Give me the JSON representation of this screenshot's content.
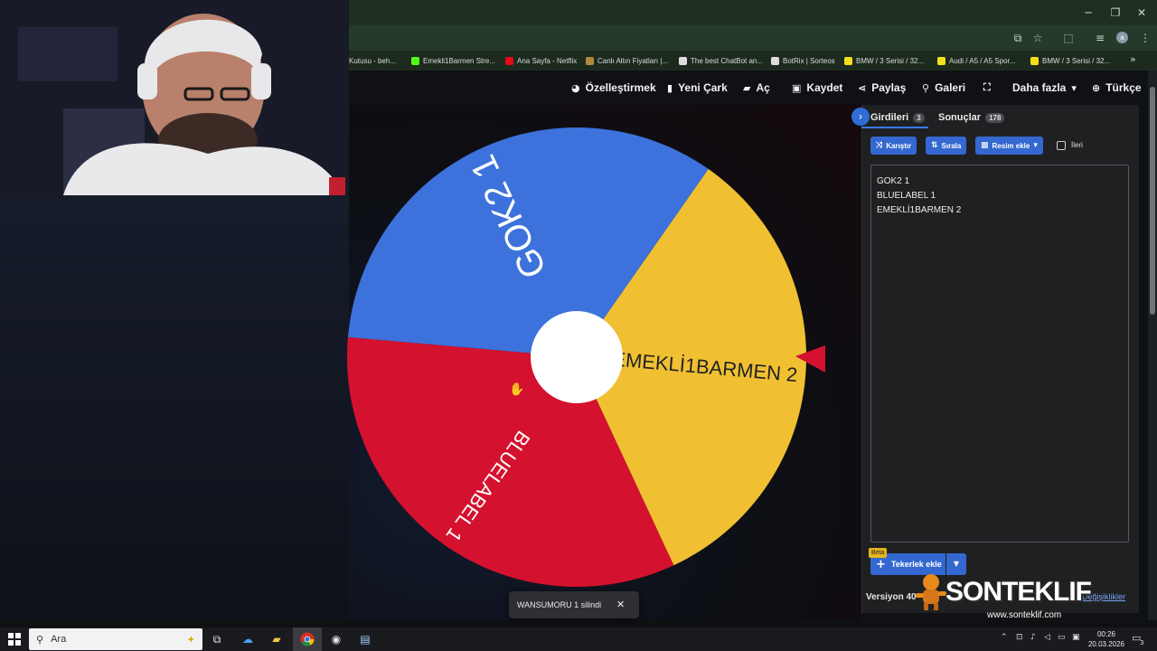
{
  "bookmarks": [
    {
      "label": "Kutusu - beh...",
      "icon": "mail-icon",
      "color": "#888888"
    },
    {
      "label": "Emekli1Barmen Stre...",
      "icon": "kick-icon",
      "color": "#53fc18"
    },
    {
      "label": "Ana Sayfa - Netflix",
      "icon": "netflix-icon",
      "color": "#e50914"
    },
    {
      "label": "Canlı Altın Fiyatları |...",
      "icon": "gold-icon",
      "color": "#b08a3c"
    },
    {
      "label": "The best ChatBot an...",
      "icon": "chatbot-icon",
      "color": "#dddddd"
    },
    {
      "label": "BotRix | Sorteos",
      "icon": "botrix-icon",
      "color": "#dddddd"
    },
    {
      "label": "BMW / 3 Serisi / 32...",
      "icon": "s-icon",
      "color": "#f3df1c"
    },
    {
      "label": "Audi / A5 / A5 Spor...",
      "icon": "s-icon",
      "color": "#f3df1c"
    },
    {
      "label": "BMW / 3 Serisi / 32...",
      "icon": "s-icon",
      "color": "#f3df1c"
    }
  ],
  "profile_initial": "a",
  "nav": {
    "customize": "Özelleştirmek",
    "new_wheel": "Yeni Çark",
    "open": "Aç",
    "save": "Kaydet",
    "share": "Paylaş",
    "gallery": "Galeri",
    "more": "Daha fazla",
    "language": "Türkçe"
  },
  "wheel": {
    "segments": [
      {
        "label": "EMEKLİ1BARMEN 2",
        "color": "#f0c032"
      },
      {
        "label": "BLUELABEL 1",
        "color": "#d4112e"
      },
      {
        "label": "GOK2 1",
        "color": "#3d72dc"
      }
    ],
    "pointer_color": "#d4112e"
  },
  "panel": {
    "tabs": [
      {
        "label": "Girdileri",
        "count": "3"
      },
      {
        "label": "Sonuçlar",
        "count": "178"
      }
    ],
    "buttons": {
      "shuffle": "Karıştır",
      "sort": "Sırala",
      "add_image": "Resim ekle"
    },
    "advanced_label": "İleri",
    "entries": [
      "GOK2 1",
      "BLUELABEL 1",
      "EMEKLİ1BARMEN 2"
    ],
    "beta": "Beta",
    "add_wheel": "Tekerlek ekle",
    "version": "Versiyon 40",
    "changes": "Değişiklikler"
  },
  "toast": {
    "message": "WANSUMORU 1 silindi",
    "close": "✕"
  },
  "watermark": {
    "brand": "SONTEKLIF",
    "url": "www.sonteklif.com"
  },
  "taskbar": {
    "search_placeholder": "Ara",
    "time": "00:26",
    "date": "20.03.2026",
    "notifications": "3"
  }
}
